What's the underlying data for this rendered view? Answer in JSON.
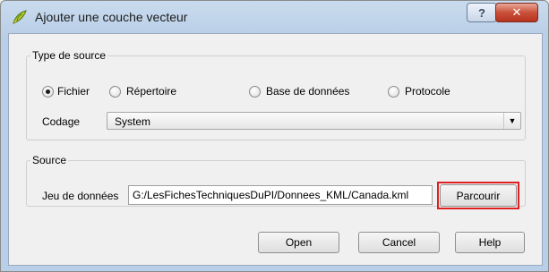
{
  "window": {
    "title": "Ajouter une couche vecteur",
    "help_glyph": "?",
    "close_glyph": "✕"
  },
  "source_type": {
    "legend": "Type de source",
    "options": [
      {
        "label": "Fichier",
        "selected": true
      },
      {
        "label": "Répertoire",
        "selected": false
      },
      {
        "label": "Base de données",
        "selected": false
      },
      {
        "label": "Protocole",
        "selected": false
      }
    ],
    "encoding_label": "Codage",
    "encoding_value": "System",
    "dropdown_glyph": "▼"
  },
  "source": {
    "legend": "Source",
    "dataset_label": "Jeu de données",
    "dataset_value": "G:/LesFichesTechniquesDuPI/Donnees_KML/Canada.kml",
    "browse_label": "Parcourir",
    "highlight_color": "#e02020"
  },
  "buttons": {
    "open": "Open",
    "cancel": "Cancel",
    "help": "Help"
  },
  "icons": {
    "app": "qgis-leaf-icon",
    "help": "help-icon",
    "close": "close-icon",
    "dropdown": "chevron-down-icon"
  }
}
